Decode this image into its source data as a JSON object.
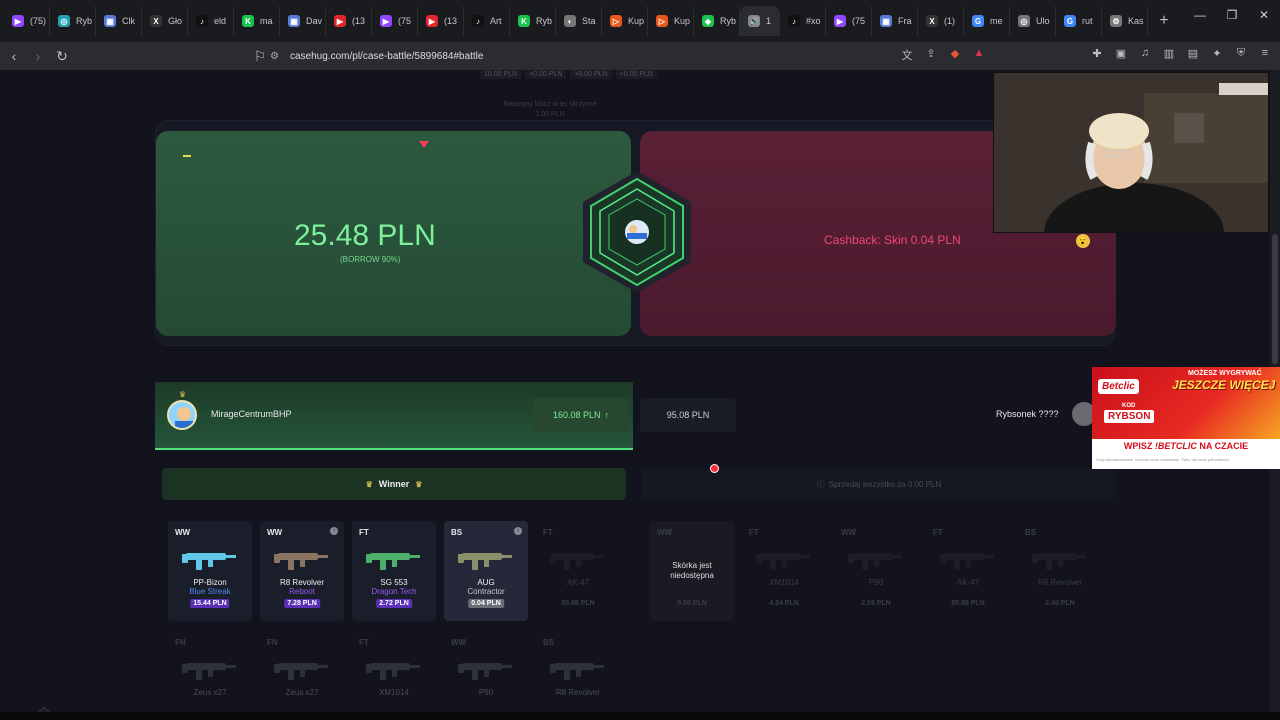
{
  "browser": {
    "tabs": [
      {
        "label": "(75)",
        "color": "#9146ff",
        "glyph": "▶"
      },
      {
        "label": "Ryb",
        "color": "#1fa1b5",
        "glyph": "◎"
      },
      {
        "label": "Clk",
        "color": "#5a7bd8",
        "glyph": "▦"
      },
      {
        "label": "Gło",
        "color": "#333333",
        "glyph": "X"
      },
      {
        "label": "eld",
        "color": "#111111",
        "glyph": "♪"
      },
      {
        "label": "ma",
        "color": "#19c24a",
        "glyph": "K"
      },
      {
        "label": "Dav",
        "color": "#5a7bd8",
        "glyph": "▦"
      },
      {
        "label": "(13",
        "color": "#e3262e",
        "glyph": "▶"
      },
      {
        "label": "(75",
        "color": "#9146ff",
        "glyph": "▶"
      },
      {
        "label": "(13",
        "color": "#e3262e",
        "glyph": "▶"
      },
      {
        "label": "Art",
        "color": "#111111",
        "glyph": "♪"
      },
      {
        "label": "Ryb",
        "color": "#19c24a",
        "glyph": "K"
      },
      {
        "label": "Sta",
        "color": "#777777",
        "glyph": "◐"
      },
      {
        "label": "Kup",
        "color": "#e8581e",
        "glyph": "▷"
      },
      {
        "label": "Kup",
        "color": "#e8581e",
        "glyph": "▷"
      },
      {
        "label": "Ryb",
        "color": "#19c24a",
        "glyph": "◆"
      },
      {
        "label": "1",
        "color": "#888888",
        "glyph": "🔊",
        "active": true
      },
      {
        "label": "#xo",
        "color": "#111111",
        "glyph": "♪"
      },
      {
        "label": "(75",
        "color": "#9146ff",
        "glyph": "▶"
      },
      {
        "label": "Fra",
        "color": "#5a7bd8",
        "glyph": "▦"
      },
      {
        "label": "(1)",
        "color": "#333333",
        "glyph": "X"
      },
      {
        "label": "me",
        "color": "#4285f4",
        "glyph": "G"
      },
      {
        "label": "Ulo",
        "color": "#777777",
        "glyph": "◎"
      },
      {
        "label": "rut",
        "color": "#4285f4",
        "glyph": "G"
      },
      {
        "label": "Kas",
        "color": "#777777",
        "glyph": "⚙"
      }
    ],
    "url": "casehug.com/pl/case-battle/5899684#battle"
  },
  "battle": {
    "faded_prices": [
      "10.00 PLN",
      "+0.00 PLN",
      "+0.00 PLN",
      "+0.00 PLN"
    ],
    "faded_note": "Nastepny klucz w tej skrzynce 1.00 PLN",
    "winner_amount": "25.48 PLN",
    "borrow_label": "(BORROW 90%)",
    "cashback_label": "Cashback: Skin 0.04 PLN",
    "player": {
      "name": "MirageCentrumBHP",
      "total": "160.08 PLN",
      "total_arrow": "↑"
    },
    "opponent": {
      "name": "Rybsonek ????",
      "total": "95.08 PLN"
    },
    "winner_label": "Winner",
    "sell_all_label": "Sprzedaj wszystko za 0.00 PLN"
  },
  "items_player_row1": [
    {
      "cond": "WW",
      "name": "PP-Bizon",
      "skin": "Blue Streak",
      "price": "15.44 PLN",
      "skin_color": "#4d8af0",
      "price_bg": "#5b2fb8",
      "gun_color": "#5fc8e8",
      "info": false
    },
    {
      "cond": "WW",
      "name": "R8 Revolver",
      "skin": "Reboot",
      "price": "7.28 PLN",
      "skin_color": "#9b58f2",
      "price_bg": "#5b2fb8",
      "gun_color": "#8a7462",
      "info": true
    },
    {
      "cond": "FT",
      "name": "SG 553",
      "skin": "Dragon Tech",
      "price": "2.72 PLN",
      "skin_color": "#9b58f2",
      "price_bg": "#5b2fb8",
      "gun_color": "#4cb06a",
      "info": false
    },
    {
      "cond": "BS",
      "name": "AUG",
      "skin": "Contractor",
      "price": "0.04 PLN",
      "skin_color": "#c8c8cc",
      "price_bg": "#6a6c76",
      "gun_color": "#8a8f6a",
      "info": true
    },
    {
      "cond": "FT",
      "name": "AK-47",
      "skin": "",
      "price": "85.88 PLN",
      "skin_color": "#3a3c48",
      "price_bg": "transparent",
      "gun_color": "#555",
      "info": false,
      "dim": true
    }
  ],
  "items_opponent_row1": [
    {
      "cond": "WW",
      "unavailable": "Skórka jest niedostępna",
      "price": "0.00 PLN"
    },
    {
      "cond": "FT",
      "name": "XM1014",
      "price": "4.24 PLN"
    },
    {
      "cond": "WW",
      "name": "P90",
      "price": "2.56 PLN"
    },
    {
      "cond": "FT",
      "name": "AK-47",
      "price": "85.88 PLN"
    },
    {
      "cond": "BS",
      "name": "R8 Revolver",
      "price": "2.40 PLN"
    }
  ],
  "items_row2": [
    {
      "cond": "FN",
      "name": "Zeus x27"
    },
    {
      "cond": "FN",
      "name": "Zeus x27"
    },
    {
      "cond": "FT",
      "name": "XM1014"
    },
    {
      "cond": "WW",
      "name": "P90"
    },
    {
      "cond": "BS",
      "name": "R8 Revolver"
    }
  ],
  "ad": {
    "brand": "Betclic",
    "headline_top": "MOŻESZ WYGRYWAĆ",
    "headline_main": "JESZCZE WIĘCEJ",
    "kod_label": "KOD",
    "kod_value": "RYBSON",
    "bottom_prefix": "WPISZ",
    "bottom_brand": "!BETCLIC",
    "bottom_suffix": "NA CZACIE",
    "fine_print": "Graj odpowiedzialnie. Hazard może uzależniać. Tylko dla osób pełnoletnich."
  },
  "colors": {
    "accent_green": "#7cf09a",
    "accent_red": "#f0457a"
  }
}
